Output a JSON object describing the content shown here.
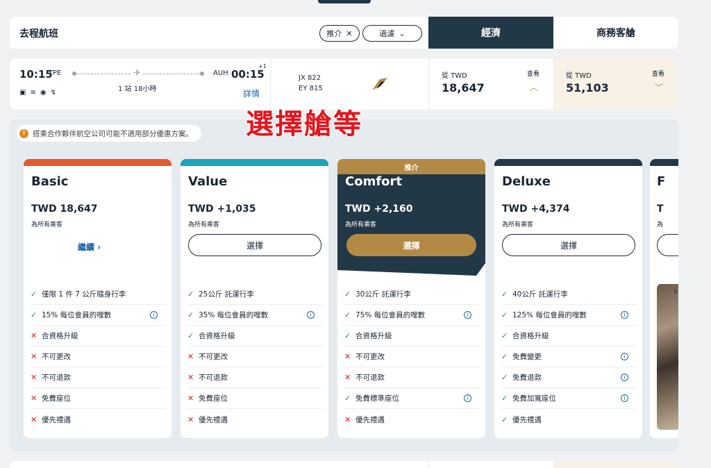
{
  "header": {
    "title": "去程航班",
    "recommend_chip": "推介",
    "filter_chip": "過濾",
    "tab_economy": "經濟",
    "tab_business": "商務客艙"
  },
  "flight": {
    "dep_time": "10:15",
    "dep_code": "TPE",
    "arr_code": "AUH",
    "arr_time": "00:15",
    "day_offset": "+1",
    "stops": "1 站 18小時",
    "detail_link": "詳情",
    "flight_no_1": "JX 822",
    "flight_no_2": "EY 815",
    "amenities": [
      "tv-icon",
      "wifi-icon",
      "usb-icon",
      "power-icon"
    ],
    "economy": {
      "from": "從 TWD",
      "price": "18,647",
      "view": "查看"
    },
    "business": {
      "from": "從 TWD",
      "price": "51,103",
      "view": "查看"
    }
  },
  "overlay_text": "選擇艙等",
  "notice": "搭乘合作夥伴航空公司可能不適用部分優惠方案。",
  "colors": {
    "basic": "#e35a2f",
    "value": "#1aa5b8",
    "comfort": "#223846",
    "deluxe": "#223846",
    "gold": "#b38a45"
  },
  "fares": [
    {
      "name": "Basic",
      "price": "TWD 18,647",
      "sub": "為所有乘客",
      "action": "繼續 ›",
      "features": [
        {
          "ok": true,
          "text": "僅限 1 件 7 公斤隨身行李",
          "info": false
        },
        {
          "ok": true,
          "text": "15% 每位會員的哩數",
          "info": true
        },
        {
          "ok": false,
          "text": "合資格升級",
          "info": false
        },
        {
          "ok": false,
          "text": "不可更改",
          "info": false
        },
        {
          "ok": false,
          "text": "不可退款",
          "info": false
        },
        {
          "ok": false,
          "text": "免費座位",
          "info": false
        },
        {
          "ok": false,
          "text": "優先禮遇",
          "info": false
        }
      ]
    },
    {
      "name": "Value",
      "price": "TWD +1,035",
      "sub": "為所有乘客",
      "action": "選擇",
      "features": [
        {
          "ok": true,
          "text": "25公斤 託運行李",
          "info": false
        },
        {
          "ok": true,
          "text": "35% 每位會員的哩數",
          "info": true
        },
        {
          "ok": true,
          "text": "合資格升級",
          "info": false
        },
        {
          "ok": false,
          "text": "不可更改",
          "info": false
        },
        {
          "ok": false,
          "text": "不可退款",
          "info": false
        },
        {
          "ok": false,
          "text": "免費座位",
          "info": false
        },
        {
          "ok": false,
          "text": "優先禮遇",
          "info": false
        }
      ]
    },
    {
      "name": "Comfort",
      "tag": "推介",
      "price": "TWD +2,160",
      "sub": "為所有乘客",
      "action": "選擇",
      "features": [
        {
          "ok": true,
          "text": "30公斤 託運行李",
          "info": false
        },
        {
          "ok": true,
          "text": "75% 每位會員的哩數",
          "info": true
        },
        {
          "ok": true,
          "text": "合資格升級",
          "info": false
        },
        {
          "ok": false,
          "text": "不可更改",
          "info": false
        },
        {
          "ok": false,
          "text": "不可退款",
          "info": false
        },
        {
          "ok": true,
          "text": "免費標準座位",
          "info": true
        },
        {
          "ok": false,
          "text": "優先禮遇",
          "info": false
        }
      ]
    },
    {
      "name": "Deluxe",
      "price": "TWD +4,374",
      "sub": "為所有乘客",
      "action": "選擇",
      "features": [
        {
          "ok": true,
          "text": "40公斤 託運行李",
          "info": false
        },
        {
          "ok": true,
          "text": "125% 每位會員的哩數",
          "info": true
        },
        {
          "ok": true,
          "text": "合資格升級",
          "info": false
        },
        {
          "ok": true,
          "text": "免費變更",
          "info": true
        },
        {
          "ok": true,
          "text": "免費退款",
          "info": true
        },
        {
          "ok": true,
          "text": "免費加寬座位",
          "info": true
        },
        {
          "ok": true,
          "text": "優先禮遇",
          "info": false
        }
      ]
    }
  ],
  "partial_card": {
    "name": "F",
    "price": "T",
    "sub": "為"
  }
}
